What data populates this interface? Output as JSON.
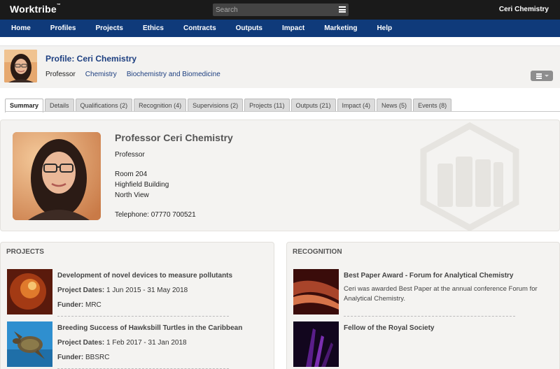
{
  "topbar": {
    "logo": "Worktribe",
    "logo_mark": "™",
    "search_placeholder": "Search",
    "username": "Ceri Chemistry"
  },
  "nav": [
    "Home",
    "Profiles",
    "Projects",
    "Ethics",
    "Contracts",
    "Outputs",
    "Impact",
    "Marketing",
    "Help"
  ],
  "header": {
    "title": "Profile: Ceri Chemistry",
    "role": "Professor",
    "department": "Chemistry",
    "school": "Biochemistry and Biomedicine"
  },
  "tabs": [
    {
      "label": "Summary",
      "active": true
    },
    {
      "label": "Details"
    },
    {
      "label": "Qualifications (2)"
    },
    {
      "label": "Recognition (4)"
    },
    {
      "label": "Supervisions (2)"
    },
    {
      "label": "Projects (11)"
    },
    {
      "label": "Outputs (21)"
    },
    {
      "label": "Impact (4)"
    },
    {
      "label": "News (5)"
    },
    {
      "label": "Events (8)"
    }
  ],
  "person": {
    "name": "Professor Ceri Chemistry",
    "title": "Professor",
    "room": "Room 204",
    "building": "Highfield Building",
    "campus": "North View",
    "telephone": "Telephone: 07770 700521"
  },
  "projects": {
    "heading": "PROJECTS",
    "items": [
      {
        "title": "Development of novel devices to measure pollutants",
        "dates_label": "Project Dates:",
        "dates": "1 Jun 2015 - 31 May 2018",
        "funder_label": "Funder:",
        "funder": "MRC"
      },
      {
        "title": "Breeding Success of Hawksbill Turtles in the Caribbean",
        "dates_label": "Project Dates:",
        "dates": "1 Feb 2017 - 31 Jan 2018",
        "funder_label": "Funder:",
        "funder": "BBSRC"
      }
    ]
  },
  "recognition": {
    "heading": "RECOGNITION",
    "items": [
      {
        "title": "Best Paper Award - Forum for Analytical Chemistry",
        "description": "Ceri was awarded Best Paper at the annual conference Forum for Analytical Chemistry."
      },
      {
        "title": "Fellow of the Royal Society"
      }
    ]
  },
  "icons": {
    "search_menu": "hamburger-icon",
    "actions": "actions-menu-icon",
    "watermark": "book-hexagon-icon"
  },
  "colors": {
    "topbar": "#1a1a1a",
    "nav": "#0f3a7a",
    "link": "#1d3f80"
  }
}
